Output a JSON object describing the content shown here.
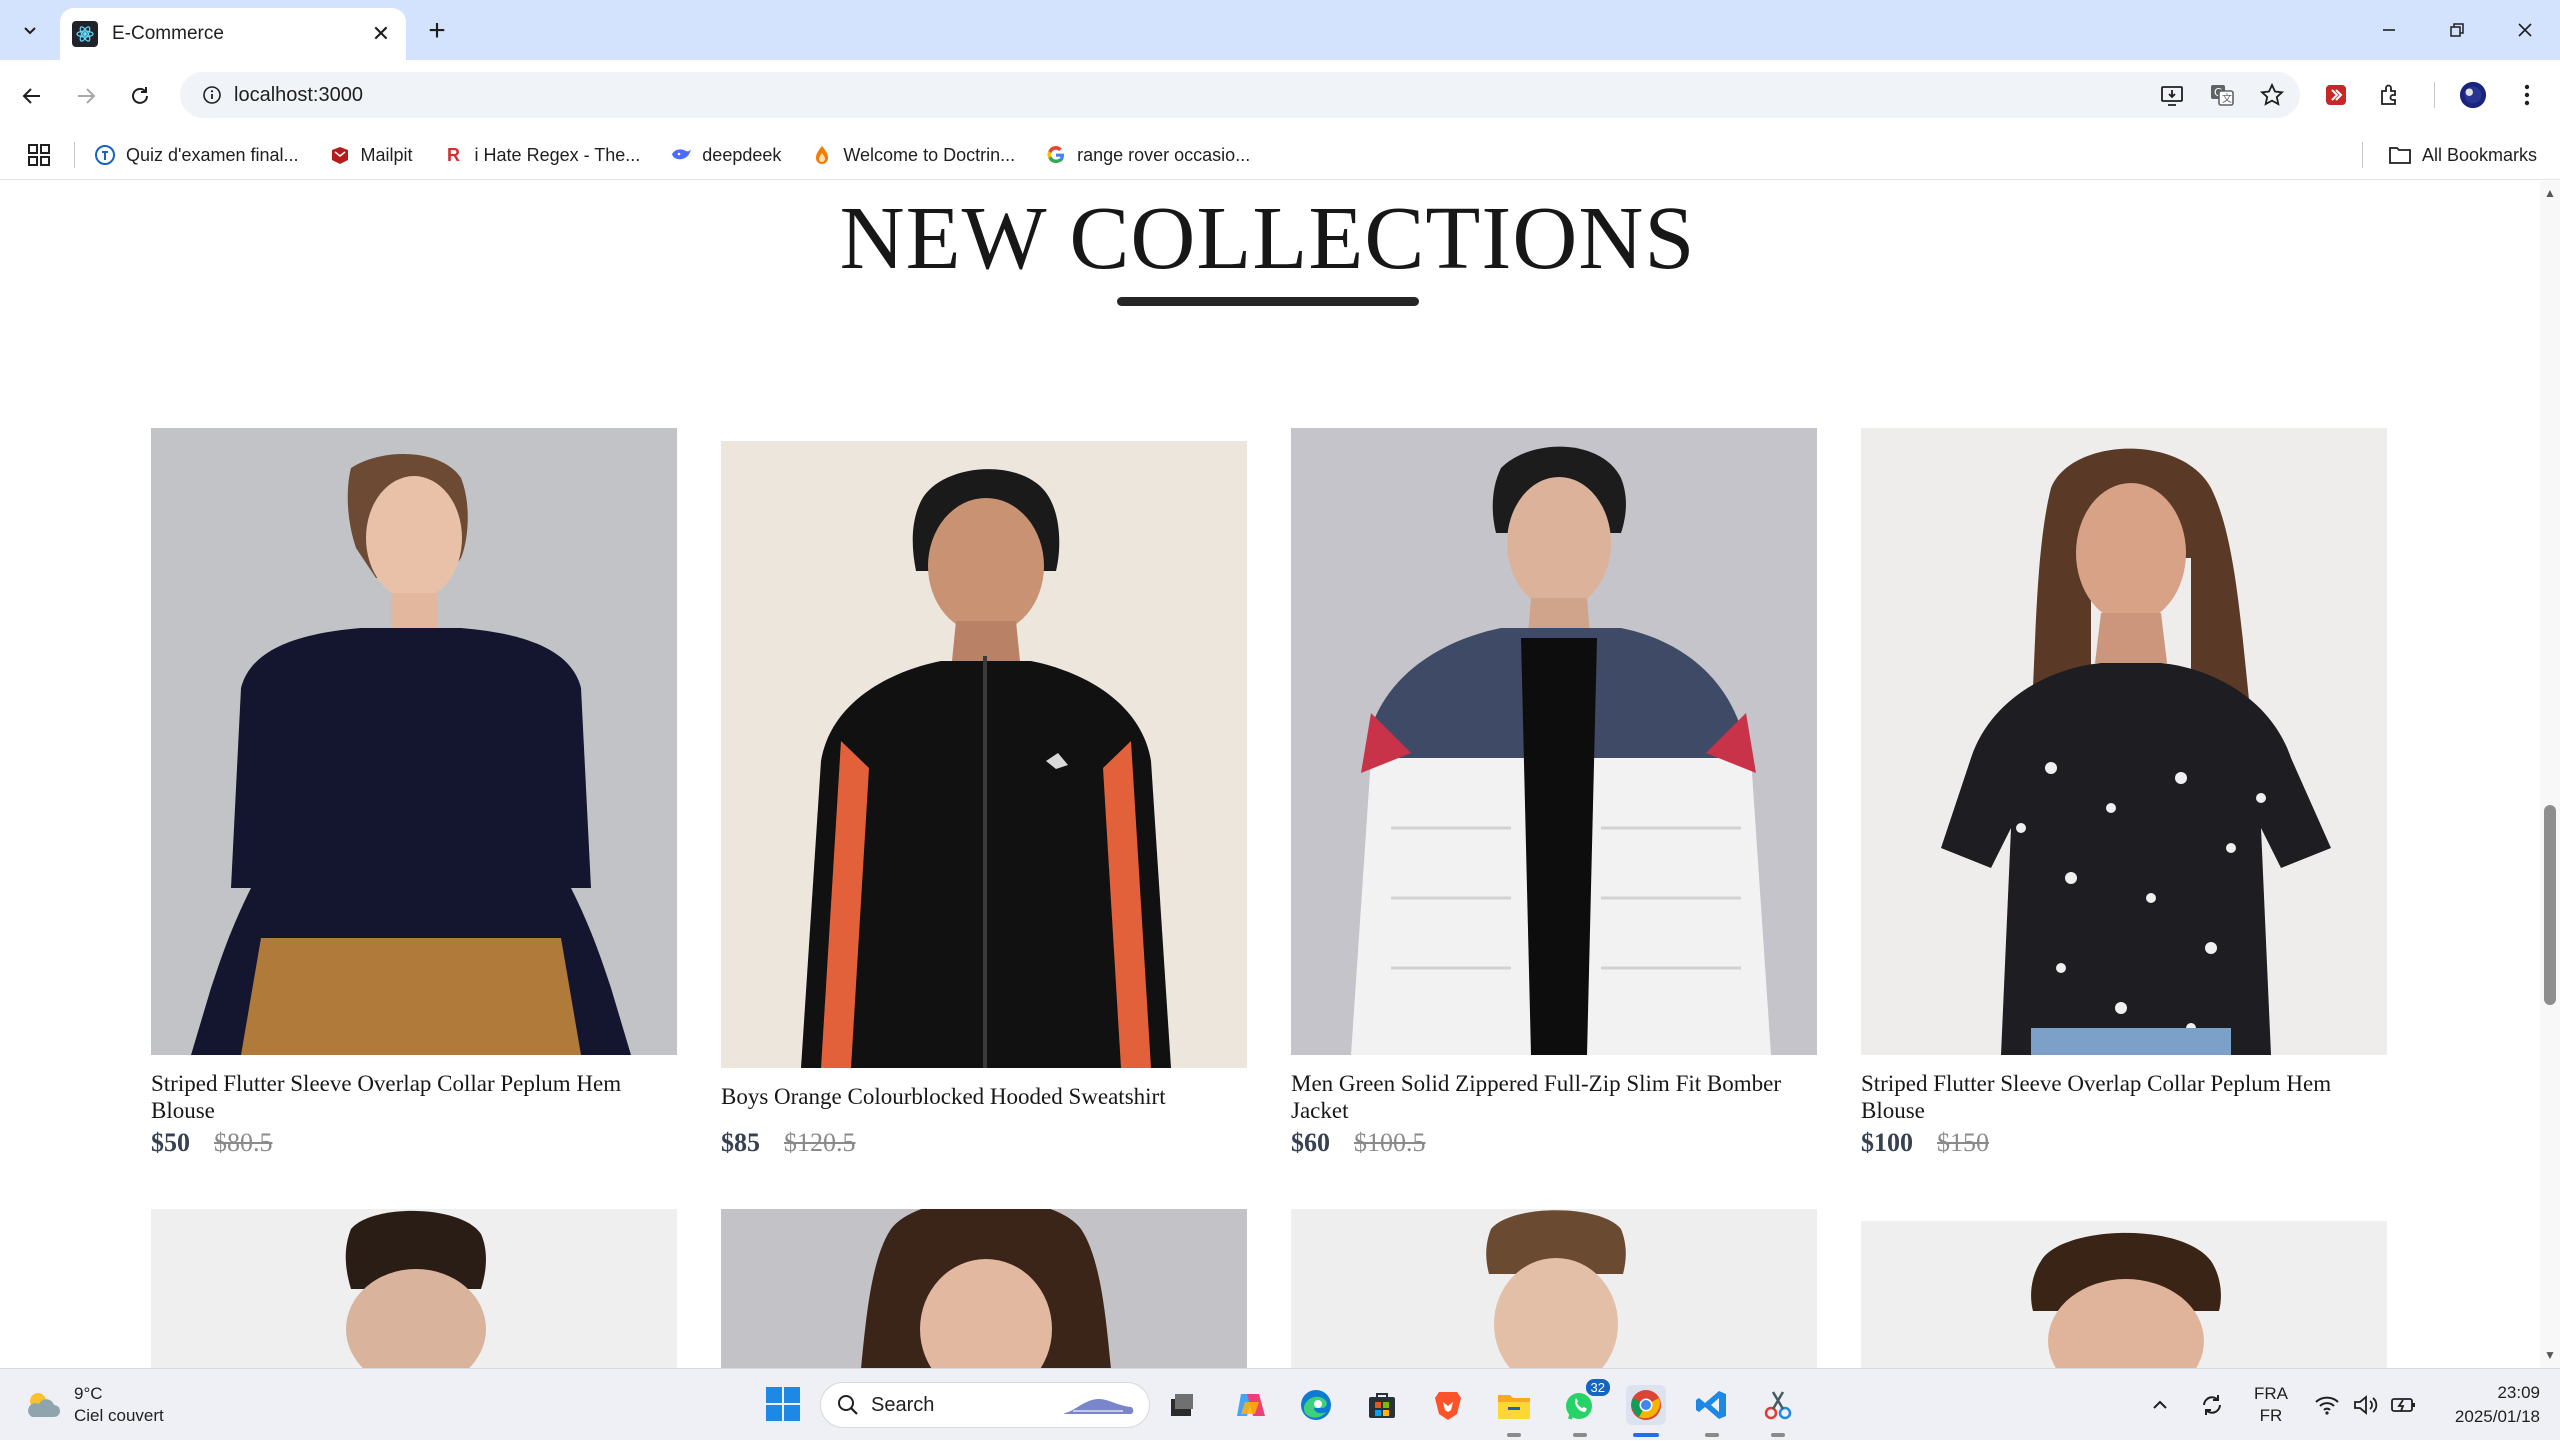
{
  "browser": {
    "tab_title": "E-Commerce",
    "url": "localhost:3000",
    "bookmarks": [
      {
        "label": "Quiz d'examen final...",
        "icon": "quiz-favicon-icon"
      },
      {
        "label": "Mailpit",
        "icon": "mailpit-favicon-icon"
      },
      {
        "label": "i Hate Regex - The...",
        "icon": "regex-favicon-icon"
      },
      {
        "label": "deepdeek",
        "icon": "deepseek-favicon-icon"
      },
      {
        "label": "Welcome to Doctrin...",
        "icon": "doctrine-favicon-icon"
      },
      {
        "label": "range rover occasio...",
        "icon": "google-favicon-icon"
      }
    ],
    "all_bookmarks_label": "All Bookmarks"
  },
  "page": {
    "section_title": "NEW COLLECTIONS",
    "products": [
      {
        "name": "Striped Flutter Sleeve Overlap Collar Peplum Hem Blouse",
        "price": "$50",
        "old_price": "$80.5",
        "image": "woman-navy-sweater-photo"
      },
      {
        "name": "Boys Orange Colourblocked Hooded Sweatshirt",
        "price": "$85",
        "old_price": "$120.5",
        "image": "boy-black-track-jacket-photo"
      },
      {
        "name": "Men Green Solid Zippered Full-Zip Slim Fit Bomber Jacket",
        "price": "$60",
        "old_price": "$100.5",
        "image": "man-white-puffer-jacket-photo"
      },
      {
        "name": "Striped Flutter Sleeve Overlap Collar Peplum Hem Blouse",
        "price": "$100",
        "old_price": "$150",
        "image": "woman-floral-blouse-photo"
      }
    ],
    "next_row_images": [
      "young-man-photo",
      "woman-photo",
      "man-smiling-photo",
      "boy-photo"
    ]
  },
  "taskbar": {
    "weather_temp": "9°C",
    "weather_desc": "Ciel couvert",
    "search_placeholder": "Search",
    "whatsapp_badge": "32",
    "language_top": "FRA",
    "language_bottom": "FR",
    "time": "23:09",
    "date": "2025/01/18"
  },
  "colors": {
    "tabstrip": "#d3e3fd",
    "title_text": "#171717",
    "price_text": "#374151",
    "old_price_text": "#8a8a8a"
  }
}
